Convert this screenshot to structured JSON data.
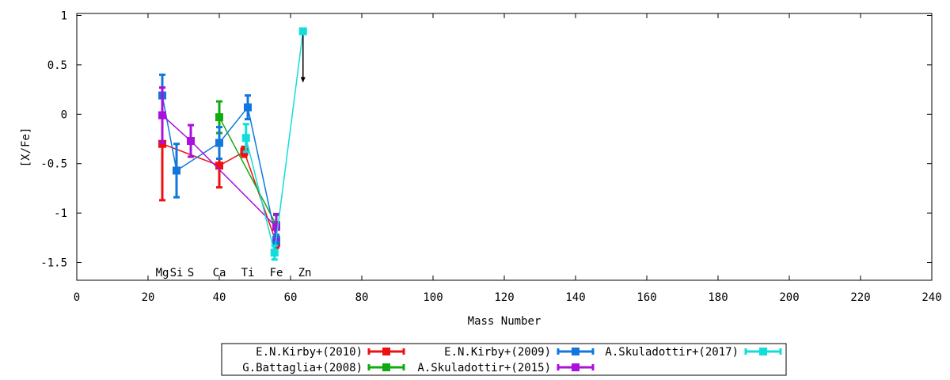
{
  "chart_data": {
    "type": "line",
    "title": "",
    "xlabel": "Mass Number",
    "ylabel": "[X/Fe]",
    "xlim": [
      0,
      240
    ],
    "ylim": [
      -1.68,
      1.02
    ],
    "grid": false,
    "legend_position": "bottom-center",
    "x_ticks": [
      {
        "value": 0,
        "label": "0"
      },
      {
        "value": 20,
        "label": "20"
      },
      {
        "value": 40,
        "label": "40"
      },
      {
        "value": 60,
        "label": "60"
      },
      {
        "value": 80,
        "label": "80"
      },
      {
        "value": 100,
        "label": "100"
      },
      {
        "value": 120,
        "label": "120"
      },
      {
        "value": 140,
        "label": "140"
      },
      {
        "value": 160,
        "label": "160"
      },
      {
        "value": 180,
        "label": "180"
      },
      {
        "value": 200,
        "label": "200"
      },
      {
        "value": 220,
        "label": "220"
      },
      {
        "value": 240,
        "label": "240"
      }
    ],
    "y_ticks": [
      {
        "value": 1,
        "label": "1"
      },
      {
        "value": 0.5,
        "label": "0.5"
      },
      {
        "value": 0,
        "label": "0"
      },
      {
        "value": -0.5,
        "label": "-0.5"
      },
      {
        "value": -1,
        "label": "-1"
      },
      {
        "value": -1.5,
        "label": "-1.5"
      }
    ],
    "element_labels": [
      {
        "text": "Mg",
        "x": 24
      },
      {
        "text": "Si",
        "x": 28
      },
      {
        "text": "S",
        "x": 32
      },
      {
        "text": "Ca",
        "x": 40
      },
      {
        "text": "Ti",
        "x": 48
      },
      {
        "text": "Fe",
        "x": 56
      },
      {
        "text": "Zn",
        "x": 64
      }
    ],
    "series": [
      {
        "name": "E.N.Kirby+(2010)",
        "color": "#ee1111",
        "points": [
          {
            "x": 24,
            "y": -0.3,
            "err": 0.57
          },
          {
            "x": 40,
            "y": -0.52,
            "err": 0.22
          },
          {
            "x": 47,
            "y": -0.38,
            "err": 0.05
          },
          {
            "x": 56,
            "y": -1.3,
            "err": 0.05
          }
        ]
      },
      {
        "name": "G.Battaglia+(2008)",
        "color": "#11aa11",
        "points": [
          {
            "x": 40,
            "y": -0.03,
            "err": 0.16
          },
          {
            "x": 56,
            "y": -1.12,
            "err": 0.1
          }
        ]
      },
      {
        "name": "E.N.Kirby+(2009)",
        "color": "#1177dd",
        "points": [
          {
            "x": 24,
            "y": 0.19,
            "err": 0.21
          },
          {
            "x": 28,
            "y": -0.57,
            "err": 0.27
          },
          {
            "x": 40,
            "y": -0.29,
            "err": 0.16
          },
          {
            "x": 48,
            "y": 0.07,
            "err": 0.12
          },
          {
            "x": 56,
            "y": -1.27,
            "err": 0.05
          }
        ]
      },
      {
        "name": "A.Skuladottir+(2015)",
        "color": "#aa11dd",
        "points": [
          {
            "x": 24,
            "y": -0.01,
            "err": 0.28
          },
          {
            "x": 32,
            "y": -0.27,
            "err": 0.16
          },
          {
            "x": 56,
            "y": -1.14,
            "err": 0.13
          }
        ]
      },
      {
        "name": "A.Skuladottir+(2017)",
        "color": "#11dddd",
        "points": [
          {
            "x": 47.5,
            "y": -0.24,
            "err": 0.14
          },
          {
            "x": 55.5,
            "y": -1.4,
            "err": 0.07
          },
          {
            "x": 63.5,
            "y": 0.84,
            "err": 0
          }
        ],
        "upper_limit_arrow": {
          "x": 63.5,
          "from": 0.84,
          "to": 0.32
        }
      }
    ]
  }
}
